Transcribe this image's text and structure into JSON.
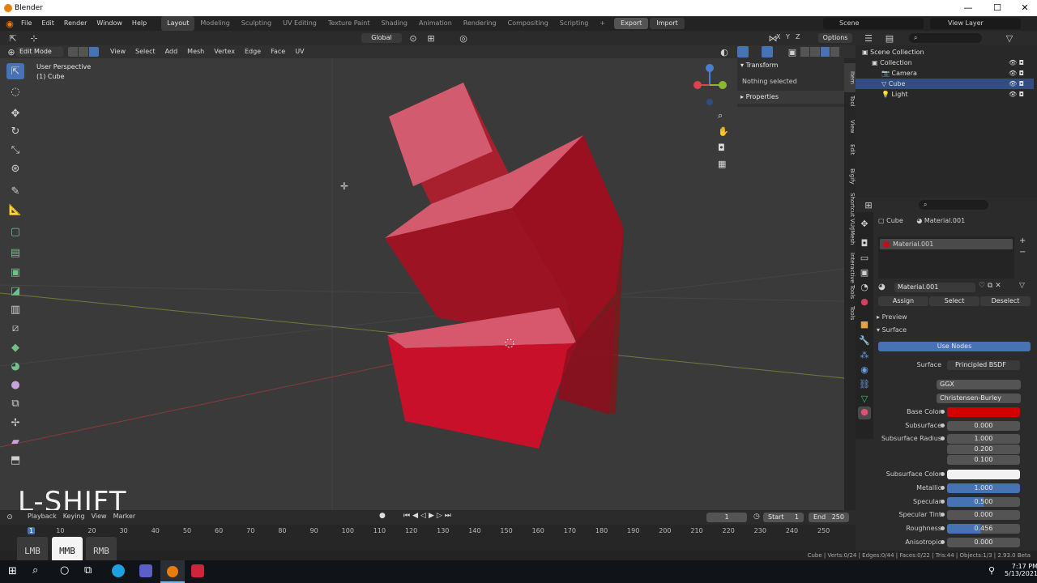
{
  "window": {
    "title": "Blender",
    "min": "—",
    "max": "☐",
    "close": "✕"
  },
  "menu": {
    "items": [
      "File",
      "Edit",
      "Render",
      "Window",
      "Help"
    ],
    "workspaces": [
      "Layout",
      "Modeling",
      "Sculpting",
      "UV Editing",
      "Texture Paint",
      "Shading",
      "Animation",
      "Rendering",
      "Compositing",
      "Scripting"
    ],
    "plus": "+",
    "export": "Export",
    "import": "Import",
    "scene": "Scene",
    "view_layer": "View Layer"
  },
  "viewport_header": {
    "transform_orientation": "Global",
    "mode": "Edit Mode",
    "menus": [
      "View",
      "Select",
      "Add",
      "Mesh",
      "Vertex",
      "Edge",
      "Face",
      "UV"
    ],
    "options": "Options",
    "axes": [
      "X",
      "Y",
      "Z"
    ]
  },
  "viewport": {
    "perspective": "User Perspective",
    "object": "(1) Cube",
    "shortcut_overlay": "L-SHIFT"
  },
  "n_panel": {
    "transform": "Transform",
    "nothing_selected": "Nothing selected",
    "properties": "Properties",
    "tabs": [
      "Item",
      "Tool",
      "View",
      "Edit",
      "Bigify",
      "Shortcut VUr",
      "JMesh",
      "Interactive Tools",
      "Tools"
    ]
  },
  "outliner": {
    "items": [
      {
        "label": "Scene Collection",
        "indent": 0
      },
      {
        "label": "Collection",
        "indent": 1
      },
      {
        "label": "Camera",
        "indent": 2
      },
      {
        "label": "Cube",
        "indent": 2,
        "selected": true
      },
      {
        "label": "Light",
        "indent": 2
      }
    ]
  },
  "properties": {
    "object": "Cube",
    "material_name": "Material.001",
    "slot": "Material.001",
    "assign": "Assign",
    "select": "Select",
    "deselect": "Deselect",
    "preview": "Preview",
    "surface_header": "Surface",
    "use_nodes": "Use Nodes",
    "surface_label": "Surface",
    "surface_value": "Principled BSDF",
    "distribution": "GGX",
    "subsurface_method": "Christensen-Burley",
    "base_color_label": "Base Color",
    "base_color": "#d40000",
    "rows": [
      {
        "label": "Subsurface",
        "value": "0.000",
        "fill": 0
      },
      {
        "label": "Subsurface Radius",
        "value": "1.000",
        "fill": 0
      },
      {
        "label": "",
        "value": "0.200",
        "fill": 0
      },
      {
        "label": "",
        "value": "0.100",
        "fill": 0
      },
      {
        "label": "Subsurface Color",
        "value": "",
        "fill": 0
      },
      {
        "label": "Metallic",
        "value": "1.000",
        "fill": 1
      },
      {
        "label": "Specular",
        "value": "0.500",
        "fill": 0.5
      },
      {
        "label": "Specular Tint",
        "value": "0.000",
        "fill": 0
      },
      {
        "label": "Roughness",
        "value": "0.456",
        "fill": 0.456
      },
      {
        "label": "Anisotropic",
        "value": "0.000",
        "fill": 0
      }
    ]
  },
  "timeline": {
    "menus": [
      "Playback",
      "Keying",
      "View",
      "Marker"
    ],
    "current_frame": "1",
    "start_label": "Start",
    "start": "1",
    "end_label": "End",
    "end": "250",
    "ticks": [
      "1",
      "10",
      "20",
      "30",
      "40",
      "50",
      "60",
      "70",
      "80",
      "90",
      "100",
      "110",
      "120",
      "130",
      "140",
      "150",
      "160",
      "170",
      "180",
      "190",
      "200",
      "210",
      "220",
      "230",
      "240",
      "250"
    ]
  },
  "status": {
    "text": "Cube | Verts:0/24 | Edges:0/44 | Faces:0/22 | Tris:44 | Objects:1/3 | 2.93.0 Beta"
  },
  "mouse_keys": [
    {
      "label": "LMB",
      "active": false
    },
    {
      "label": "MMB",
      "active": true
    },
    {
      "label": "RMB",
      "active": false
    }
  ],
  "taskbar": {
    "time": "7:17 PM",
    "date": "5/13/2021"
  }
}
